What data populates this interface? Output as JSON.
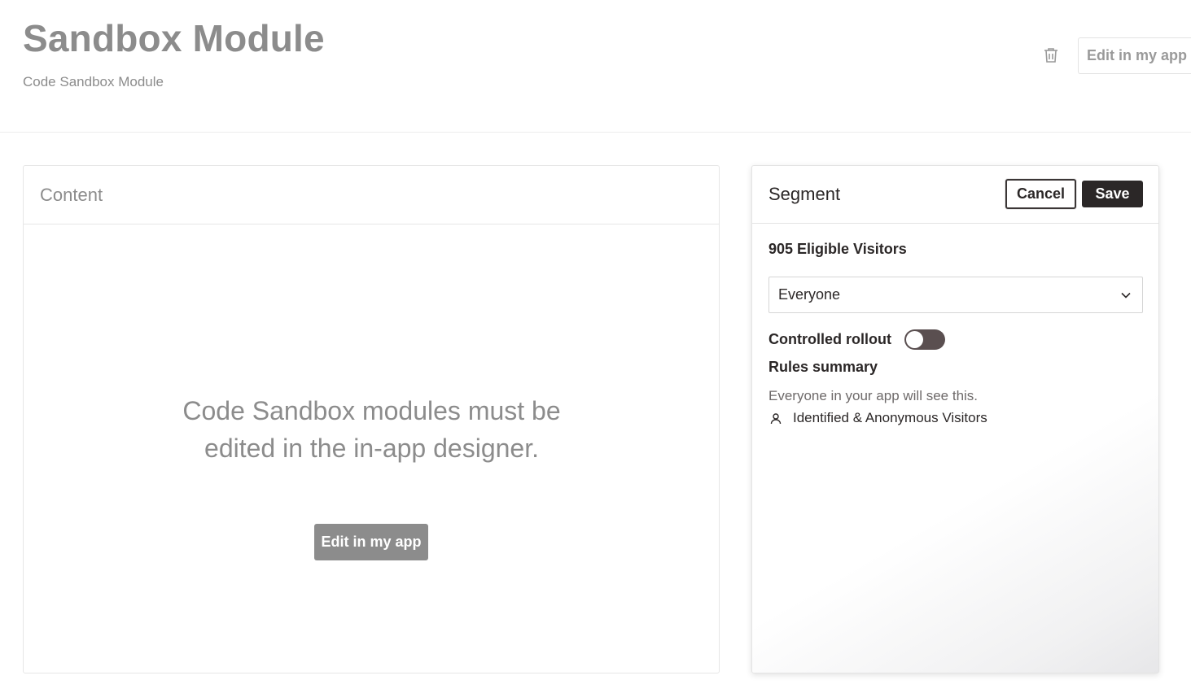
{
  "header": {
    "title": "Sandbox Module",
    "subtitle": "Code Sandbox Module",
    "edit_button_label": "Edit in my app",
    "delete_icon": "trash-icon"
  },
  "content": {
    "title": "Content",
    "message": "Code Sandbox modules must be edited in the in-app designer.",
    "edit_button_label": "Edit in my app"
  },
  "segment": {
    "title": "Segment",
    "cancel_label": "Cancel",
    "save_label": "Save",
    "eligible_visitors": "905 Eligible Visitors",
    "selected_segment": "Everyone",
    "controlled_rollout_label": "Controlled rollout",
    "controlled_rollout_enabled": false,
    "rules_summary_label": "Rules summary",
    "rules_summary_text": "Everyone in your app will see this.",
    "visitor_type": "Identified & Anonymous Visitors",
    "visitor_icon": "person-icon",
    "dropdown_icon": "chevron-down-icon"
  },
  "colors": {
    "muted_gray": "#8c8c8c",
    "dark": "#2b2727",
    "toggle_off": "#5a4f50"
  }
}
